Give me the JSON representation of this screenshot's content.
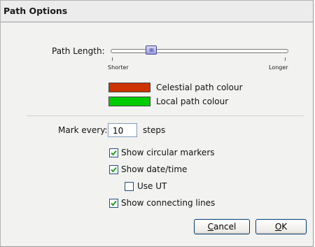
{
  "dialog": {
    "title": "Path Options"
  },
  "path_length": {
    "label": "Path Length:",
    "min_label": "Shorter",
    "max_label": "Longer",
    "value_fraction": 0.2
  },
  "colours": {
    "celestial": {
      "label": "Celestial path colour",
      "color": "#cc3300"
    },
    "local": {
      "label": "Local path colour",
      "color": "#00cc00"
    }
  },
  "mark_every": {
    "label": "Mark every:",
    "value": "10",
    "unit": "steps"
  },
  "options": {
    "circular_markers": {
      "label": "Show circular markers",
      "checked": true
    },
    "date_time": {
      "label": "Show date/time",
      "checked": true
    },
    "use_ut": {
      "label": "Use UT",
      "checked": false
    },
    "connecting_lines": {
      "label": "Show connecting lines",
      "checked": true
    }
  },
  "buttons": {
    "cancel": {
      "mnemonic": "C",
      "rest": "ancel"
    },
    "ok": {
      "mnemonic": "O",
      "rest": "K"
    }
  }
}
